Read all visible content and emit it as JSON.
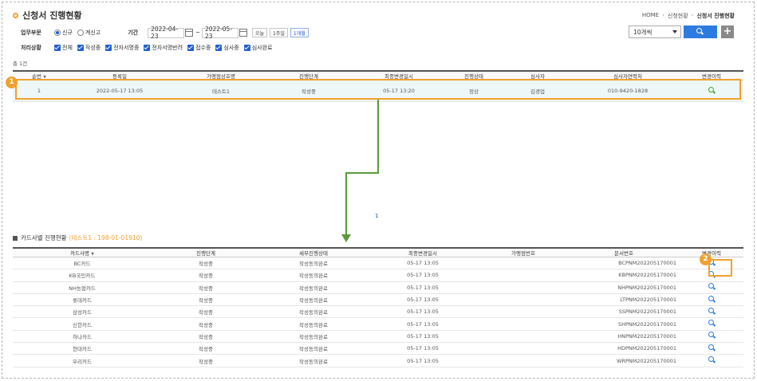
{
  "header": {
    "title": "신청서 진행현황",
    "breadcrumb": [
      "HOME",
      "신청현황",
      "신청서 진행현황"
    ]
  },
  "filters": {
    "business_label": "업무부문",
    "business_options": [
      {
        "label": "신규",
        "selected": true
      },
      {
        "label": "계신고",
        "selected": false
      }
    ],
    "period_label": "기간",
    "date_from": "2022-04-23",
    "date_sep": "~",
    "date_to": "2022-05-23",
    "quick_ranges": [
      {
        "label": "오늘",
        "active": false
      },
      {
        "label": "1주일",
        "active": false
      },
      {
        "label": "1개월",
        "active": true
      }
    ],
    "status_label": "처리상황",
    "statuses": [
      "전체",
      "작성중",
      "전자서명중",
      "전자서명반려",
      "접수중",
      "심사중",
      "심사완료"
    ],
    "page_size": "10개씩"
  },
  "summary": {
    "count_text": "총 1건"
  },
  "table1": {
    "columns": [
      "순번",
      "등록일",
      "가맹점상호명",
      "진행단계",
      "최종변경일시",
      "진행상태",
      "심사자",
      "심사자연락처",
      "변경이력"
    ],
    "rows": [
      [
        "1",
        "2022-05-17 13:05",
        "테스트1",
        "작성중",
        "05-17 13:20",
        "정상",
        "김경업",
        "010-9420-1828"
      ]
    ]
  },
  "pager": {
    "current": "1"
  },
  "markers": {
    "m1": "1",
    "m2": "2"
  },
  "section2": {
    "title": "카드사별 진행현황",
    "subtitle": "(테스트1 : 198-01-01910)"
  },
  "table2": {
    "columns": [
      "카드사명",
      "진행단계",
      "세부진행상태",
      "최종변경일시",
      "가맹점번호",
      "문서번호",
      "변경이력"
    ],
    "rows": [
      [
        "BC카드",
        "작성중",
        "작성동의완료",
        "05-17 13:05",
        "",
        "BCPNM202205170001"
      ],
      [
        "KB국민카드",
        "작성중",
        "작성동의완료",
        "05-17 13:05",
        "",
        "KBPNM202205170001"
      ],
      [
        "NH농협카드",
        "작성중",
        "작성동의완료",
        "05-17 13:05",
        "",
        "NHPNM202205170001"
      ],
      [
        "롯데카드",
        "작성중",
        "작성동의완료",
        "05-17 13:05",
        "",
        "LTPNM202205170001"
      ],
      [
        "삼성카드",
        "작성중",
        "작성동의완료",
        "05-17 13:05",
        "",
        "SSPNM202205170001"
      ],
      [
        "신한카드",
        "작성중",
        "작성동의완료",
        "05-17 13:05",
        "",
        "SHPNM202205170001"
      ],
      [
        "하나카드",
        "작성중",
        "작성동의완료",
        "05-17 13:05",
        "",
        "HNPNM202205170001"
      ],
      [
        "현대카드",
        "작성중",
        "작성동의완료",
        "05-17 13:05",
        "",
        "HDPNM202205170001"
      ],
      [
        "우리카드",
        "작성중",
        "작성동의완료",
        "05-17 13:05",
        "",
        "WRPNM202205170001"
      ]
    ]
  },
  "icons": {
    "history": "magnifier-icon",
    "search": "magnifier-icon",
    "add": "plus-icon",
    "calendar": "calendar-icon"
  },
  "colors": {
    "accent": "#f0a12e",
    "primary": "#2d7be0",
    "arrow": "#5a9a3a",
    "row_highlight": "#eef7f7"
  }
}
